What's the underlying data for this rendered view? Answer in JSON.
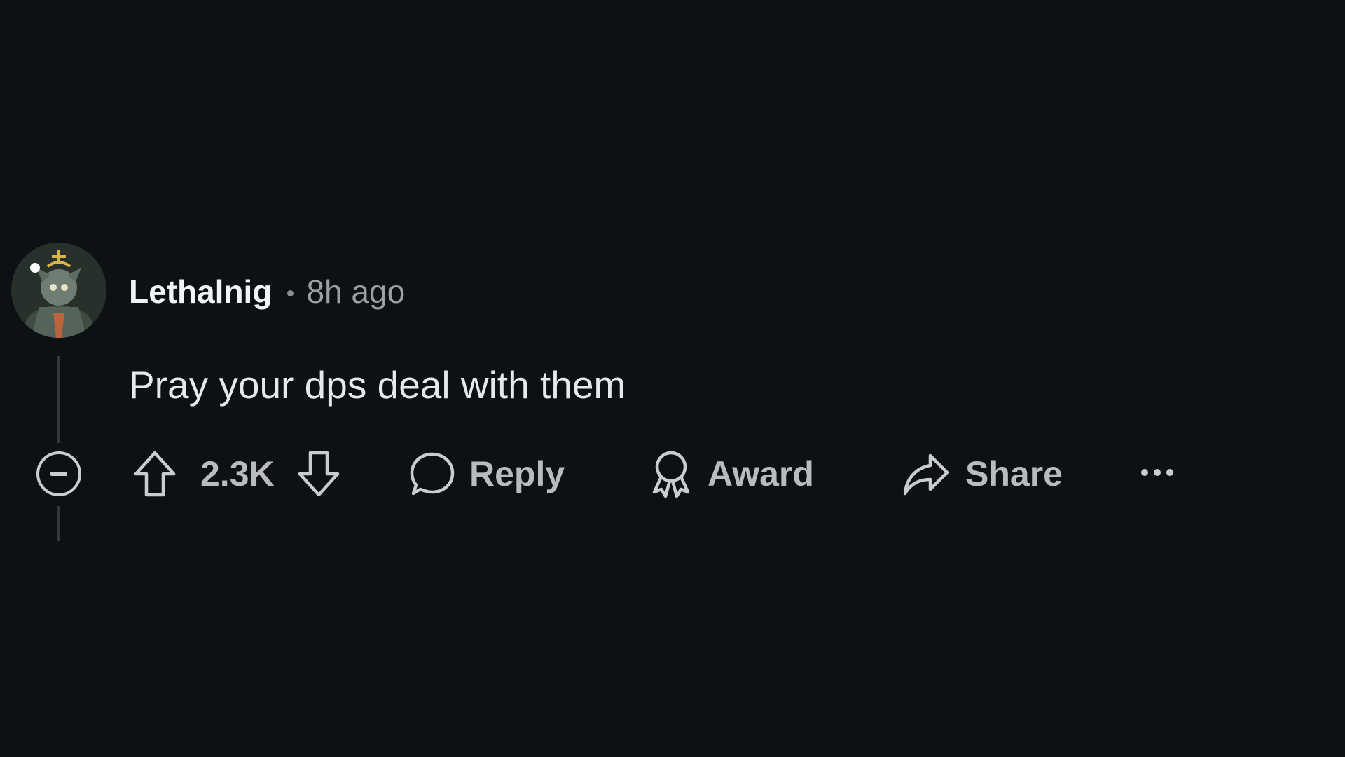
{
  "comment": {
    "author": "Lethalnig",
    "time_ago": "8h ago",
    "text": "Pray your dps deal with them"
  },
  "actions": {
    "vote_count": "2.3K",
    "reply_label": "Reply",
    "award_label": "Award",
    "share_label": "Share"
  },
  "icons": {
    "collapse": "minus-circle-icon",
    "upvote": "arrow-up-icon",
    "downvote": "arrow-down-icon",
    "reply": "speech-bubble-icon",
    "award": "award-ribbon-icon",
    "share": "share-arrow-icon",
    "more": "ellipsis-icon"
  },
  "colors": {
    "background": "#0e1114",
    "username": "#f2f3f5",
    "timestamp": "#9aa0a5",
    "body_text": "#e6e8ea",
    "action_text": "#b8bcc0"
  }
}
